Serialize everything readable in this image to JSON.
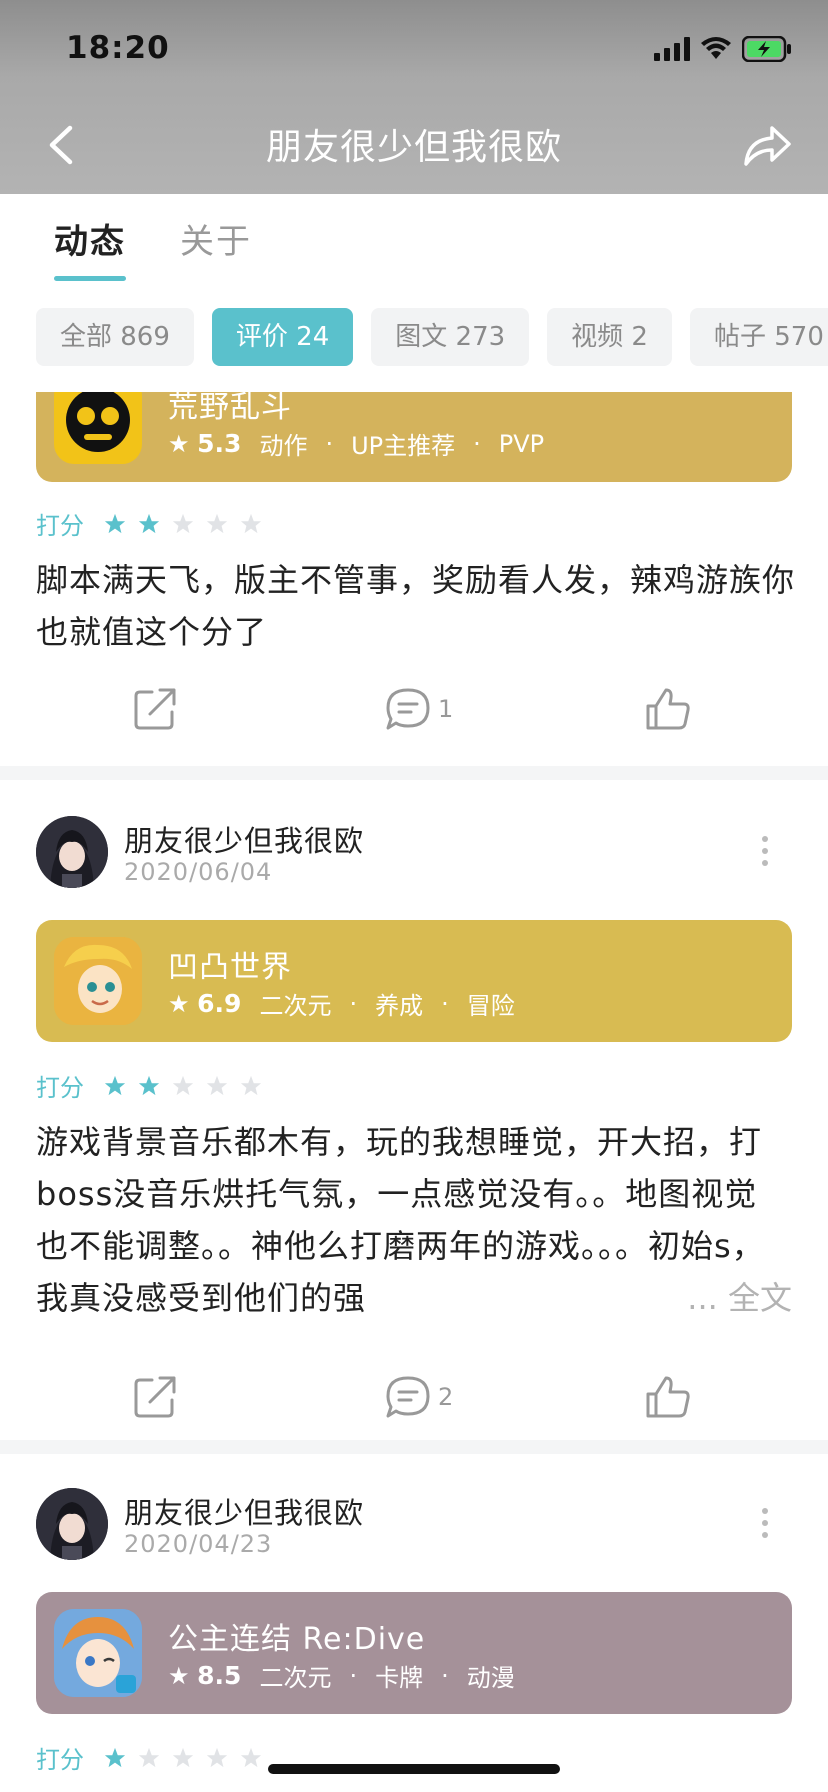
{
  "status_bar": {
    "time": "18:20"
  },
  "nav": {
    "title": "朋友很少但我很欧"
  },
  "tabs": [
    {
      "label": "动态",
      "active": true
    },
    {
      "label": "关于",
      "active": false
    }
  ],
  "filters": [
    {
      "label": "全部 869",
      "active": false
    },
    {
      "label": "评价 24",
      "active": true
    },
    {
      "label": "图文 273",
      "active": false
    },
    {
      "label": "视频 2",
      "active": false
    },
    {
      "label": "帖子 570",
      "active": false
    }
  ],
  "accent_color": "#5ac1cc",
  "posts": [
    {
      "game": {
        "name": "荒野乱斗",
        "rating": "5.3",
        "tags": [
          "动作",
          "UP主推荐",
          "PVP"
        ],
        "card_color": "#d4b35c"
      },
      "rating_label": "打分",
      "stars": 2,
      "text": "脚本满天飞，版主不管事，奖励看人发，辣鸡游族你也就值这个分了",
      "comments": "1"
    },
    {
      "user": {
        "name": "朋友很少但我很欧",
        "date": "2020/06/04"
      },
      "game": {
        "name": "凹凸世界",
        "rating": "6.9",
        "tags": [
          "二次元",
          "养成",
          "冒险"
        ],
        "card_color": "#d8bb52"
      },
      "rating_label": "打分",
      "stars": 2,
      "text": "游戏背景音乐都木有，玩的我想睡觉，开大招，打boss没音乐烘托气氛，一点感觉没有。。地图视觉也不能调整。。神他么打磨两年的游戏。。。初始s，我真没感受到他们的强",
      "more_label": "... 全文",
      "comments": "2"
    },
    {
      "user": {
        "name": "朋友很少但我很欧",
        "date": "2020/04/23"
      },
      "game": {
        "name": "公主连结 Re:Dive",
        "rating": "8.5",
        "tags": [
          "二次元",
          "卡牌",
          "动漫"
        ],
        "card_color": "#a59199"
      },
      "rating_label": "打分",
      "stars": 1
    }
  ]
}
